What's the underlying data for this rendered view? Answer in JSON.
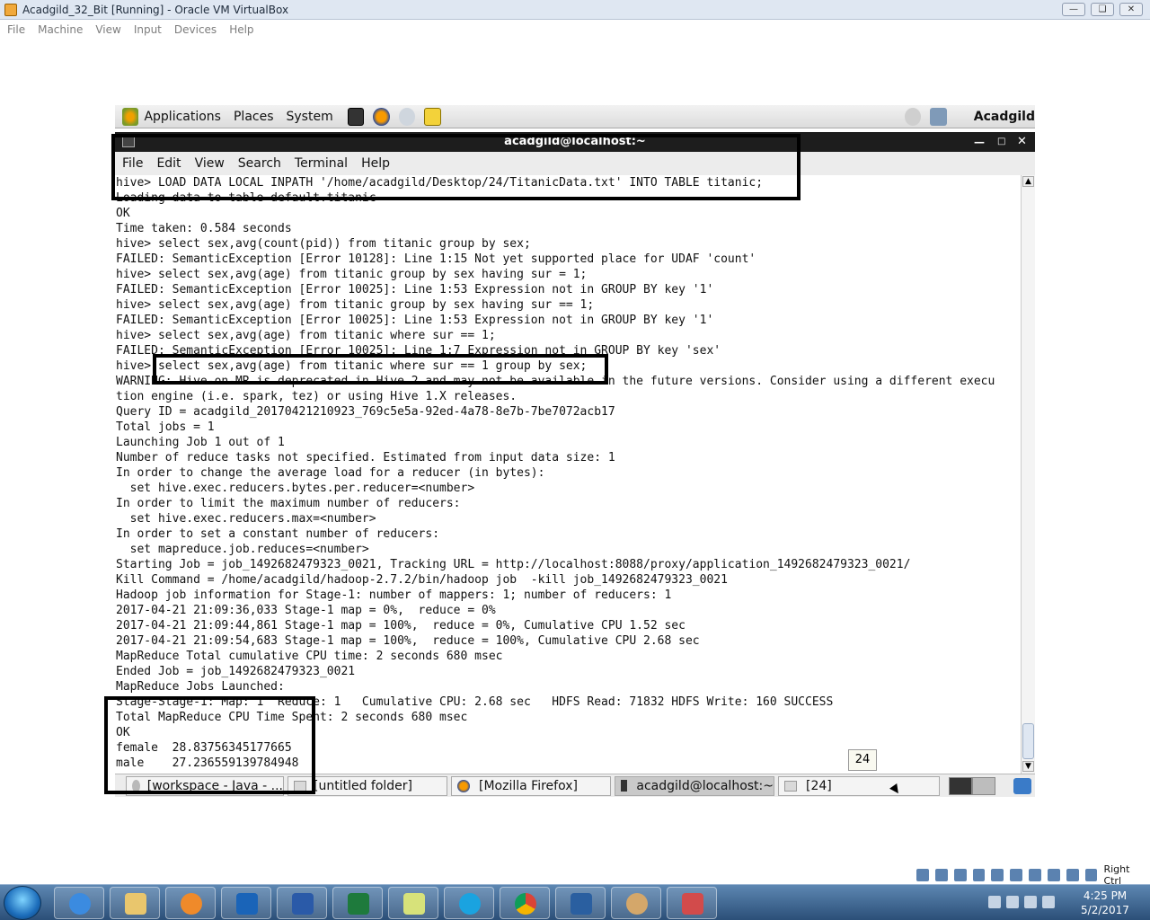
{
  "vbox": {
    "title": "Acadgild_32_Bit [Running] - Oracle VM VirtualBox",
    "menu": [
      "File",
      "Machine",
      "View",
      "Input",
      "Devices",
      "Help"
    ]
  },
  "guest_panel": {
    "applications": "Applications",
    "places": "Places",
    "system": "System",
    "user": "Acadgild"
  },
  "terminal": {
    "title": "acadgild@localhost:~",
    "menu": [
      "File",
      "Edit",
      "View",
      "Search",
      "Terminal",
      "Help"
    ],
    "lines": [
      "hive> LOAD DATA LOCAL INPATH '/home/acadgild/Desktop/24/TitanicData.txt' INTO TABLE titanic;",
      "Loading data to table default.titanic",
      "OK",
      "Time taken: 0.584 seconds",
      "hive> select sex,avg(count(pid)) from titanic group by sex;",
      "FAILED: SemanticException [Error 10128]: Line 1:15 Not yet supported place for UDAF 'count'",
      "hive> select sex,avg(age) from titanic group by sex having sur = 1;",
      "FAILED: SemanticException [Error 10025]: Line 1:53 Expression not in GROUP BY key '1'",
      "hive> select sex,avg(age) from titanic group by sex having sur == 1;",
      "FAILED: SemanticException [Error 10025]: Line 1:53 Expression not in GROUP BY key '1'",
      "hive> select sex,avg(age) from titanic where sur == 1;",
      "FAILED: SemanticException [Error 10025]: Line 1:7 Expression not in GROUP BY key 'sex'",
      "hive> select sex,avg(age) from titanic where sur == 1 group by sex;",
      "WARNING: Hive-on-MR is deprecated in Hive 2 and may not be available in the future versions. Consider using a different execu",
      "tion engine (i.e. spark, tez) or using Hive 1.X releases.",
      "Query ID = acadgild_20170421210923_769c5e5a-92ed-4a78-8e7b-7be7072acb17",
      "Total jobs = 1",
      "Launching Job 1 out of 1",
      "Number of reduce tasks not specified. Estimated from input data size: 1",
      "In order to change the average load for a reducer (in bytes):",
      "  set hive.exec.reducers.bytes.per.reducer=<number>",
      "In order to limit the maximum number of reducers:",
      "  set hive.exec.reducers.max=<number>",
      "In order to set a constant number of reducers:",
      "  set mapreduce.job.reduces=<number>",
      "Starting Job = job_1492682479323_0021, Tracking URL = http://localhost:8088/proxy/application_1492682479323_0021/",
      "Kill Command = /home/acadgild/hadoop-2.7.2/bin/hadoop job  -kill job_1492682479323_0021",
      "Hadoop job information for Stage-1: number of mappers: 1; number of reducers: 1",
      "2017-04-21 21:09:36,033 Stage-1 map = 0%,  reduce = 0%",
      "2017-04-21 21:09:44,861 Stage-1 map = 100%,  reduce = 0%, Cumulative CPU 1.52 sec",
      "2017-04-21 21:09:54,683 Stage-1 map = 100%,  reduce = 100%, Cumulative CPU 2.68 sec",
      "MapReduce Total cumulative CPU time: 2 seconds 680 msec",
      "Ended Job = job_1492682479323_0021",
      "MapReduce Jobs Launched:",
      "Stage-Stage-1: Map: 1  Reduce: 1   Cumulative CPU: 2.68 sec   HDFS Read: 71832 HDFS Write: 160 SUCCESS",
      "Total MapReduce CPU Time Spent: 2 seconds 680 msec",
      "OK",
      "female  28.83756345177665",
      "male    27.236559139784948"
    ]
  },
  "guest_taskbar": [
    "[workspace - Java - ...",
    "[untitled folder]",
    "[Mozilla Firefox]",
    "acadgild@localhost:~",
    "[24]"
  ],
  "tooltip": "24",
  "host_tray": {
    "right_ctrl": "Right Ctrl"
  },
  "clock": {
    "time": "4:25 PM",
    "date": "5/2/2017"
  }
}
